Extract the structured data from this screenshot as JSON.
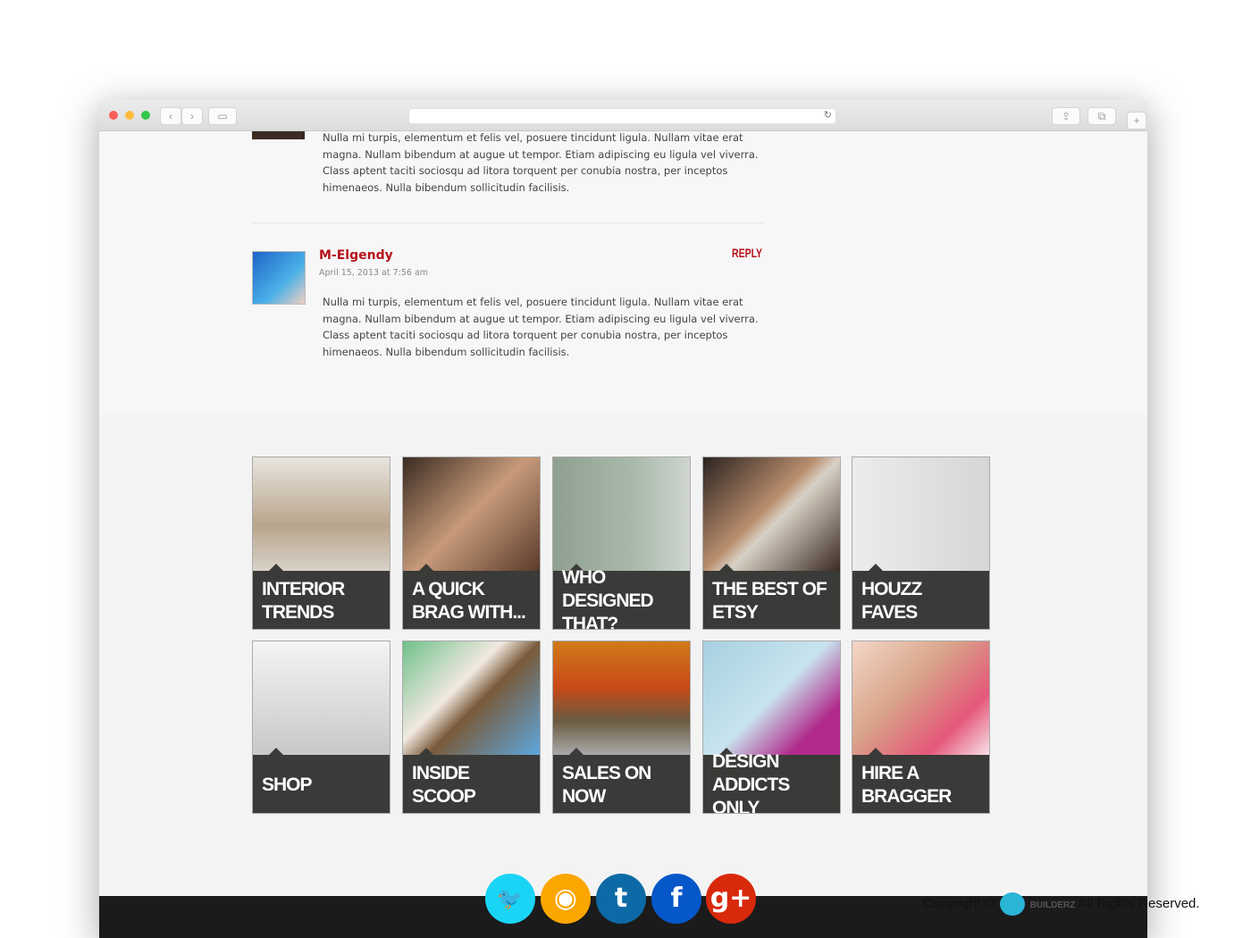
{
  "comments": [
    {
      "text": "Nulla mi turpis, elementum et felis vel, posuere tincidunt ligula. Nullam vitae erat magna. Nullam bibendum at augue ut tempor. Etiam adipiscing eu ligula vel viverra. Class aptent taciti sociosqu ad litora torquent per conubia nostra, per inceptos himenaeos. Nulla bibendum sollicitudin facilisis."
    },
    {
      "author": "M-Elgendy",
      "date": "April 15, 2013 at 7:56 am",
      "reply": "REPLY",
      "text": "Nulla mi turpis, elementum et felis vel, posuere tincidunt ligula. Nullam vitae erat magna. Nullam bibendum at augue ut tempor. Etiam adipiscing eu ligula vel viverra. Class aptent taciti sociosqu ad litora torquent per conubia nostra, per inceptos himenaeos. Nulla bibendum sollicitudin facilisis."
    }
  ],
  "tiles": [
    {
      "label": "INTERIOR TRENDS"
    },
    {
      "label": "A QUICK BRAG WITH..."
    },
    {
      "label": "WHO DESIGNED THAT?"
    },
    {
      "label": "THE BEST OF ETSY"
    },
    {
      "label": "HOUZZ FAVES"
    },
    {
      "label": "SHOP"
    },
    {
      "label": "INSIDE SCOOP"
    },
    {
      "label": "SALES ON NOW"
    },
    {
      "label": "DESIGN ADDICTS ONLY"
    },
    {
      "label": "HIRE A BRAGGER"
    }
  ],
  "social": [
    {
      "icon": "twitter-icon",
      "glyph": "🐦",
      "color": "#1ad4f5"
    },
    {
      "icon": "rss-icon",
      "glyph": "◉",
      "color": "#fca600"
    },
    {
      "icon": "tumblr-icon",
      "glyph": "t",
      "color": "#0d6aa6"
    },
    {
      "icon": "facebook-icon",
      "glyph": "f",
      "color": "#0657c9"
    },
    {
      "icon": "google-plus-icon",
      "glyph": "g+",
      "color": "#d8290b"
    }
  ],
  "footer": {
    "copyright": "Copyright ©",
    "rights": "All Rights Reserved.",
    "logo_text": "BUILDERZ"
  },
  "colors": {
    "accent": "#b5121b",
    "tile_label": "#3a3a38",
    "footer": "#1b1b1b"
  }
}
